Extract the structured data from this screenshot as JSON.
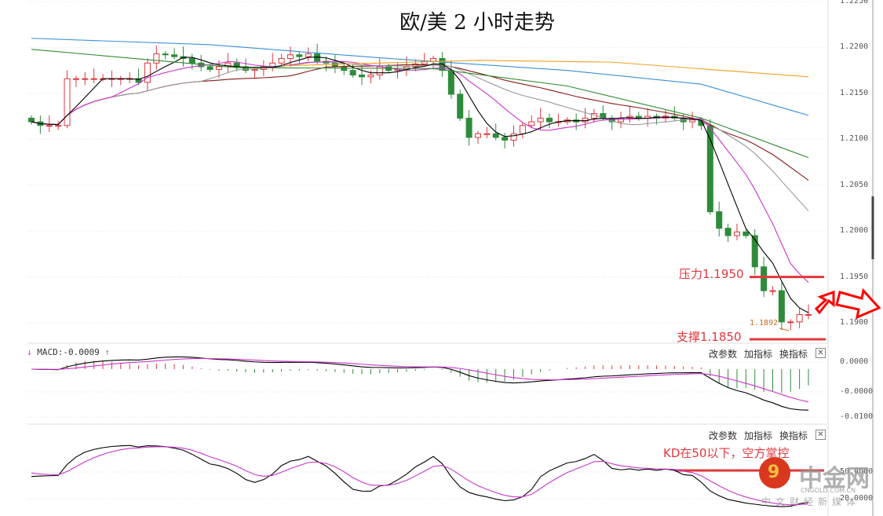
{
  "title": "欧/美 2 小时走势",
  "toolbar": {
    "params": "改参数",
    "add": "加指标",
    "switch": "换指标",
    "close": "✕"
  },
  "macd_label": "MACD:-0.0009",
  "annotations": {
    "resistance": "压力1.1950",
    "support": "支撑1.1850",
    "low": "1.1892",
    "kd_note": "KD在50以下，空方掌控"
  },
  "watermark": {
    "name": "中金网",
    "site": "CNGOLD.COM.CN",
    "slogan": "中文财经新媒体"
  },
  "colors": {
    "up": "#e0383e",
    "down": "#2e8b3a",
    "ma5": "#000000",
    "ma10": "#cc33cc",
    "ma20": "#999999",
    "ma30": "#8b1a1a",
    "ma60": "#2e8b2e",
    "blue": "#3a8fd6",
    "orange": "#f0a020",
    "annot": "#e0383e"
  },
  "chart_data": {
    "type": "candlestick",
    "title": "欧/美 2 小时走势",
    "ylim": [
      1.1895,
      1.225
    ],
    "yticks": [
      "1.2250",
      "1.2200",
      "1.2150",
      "1.2100",
      "1.2050",
      "1.2000",
      "1.1950",
      "1.1900"
    ],
    "macd_ticks": [
      "0.0000",
      "-0.0000",
      "-0.0100"
    ],
    "kd_ticks": [
      "50.0000",
      "20.0000"
    ],
    "closes": [
      1.2119,
      1.2115,
      1.2115,
      1.2115,
      1.2166,
      1.2166,
      1.2166,
      1.2166,
      1.2166,
      1.2166,
      1.2166,
      1.2166,
      1.2162,
      1.2183,
      1.2193,
      1.2192,
      1.219,
      1.2188,
      1.2183,
      1.2179,
      1.2176,
      1.2179,
      1.2183,
      1.2179,
      1.2175,
      1.2176,
      1.2179,
      1.2183,
      1.2188,
      1.2192,
      1.219,
      1.2193,
      1.2185,
      1.2183,
      1.2179,
      1.2175,
      1.217,
      1.2168,
      1.217,
      1.2179,
      1.2175,
      1.2176,
      1.2179,
      1.2182,
      1.2185,
      1.2188,
      1.2175,
      1.2149,
      1.2123,
      1.2102,
      1.2106,
      1.2106,
      1.2102,
      1.2099,
      1.2106,
      1.2115,
      1.2119,
      1.2123,
      1.2119,
      1.2119,
      1.2121,
      1.2119,
      1.2123,
      1.2128,
      1.2123,
      1.2119,
      1.2123,
      1.2125,
      1.2123,
      1.2125,
      1.2123,
      1.2125,
      1.2123,
      1.2119,
      1.2121,
      1.2115,
      1.2021,
      1.2003,
      1.1995,
      1.1999,
      1.1995,
      1.1961,
      1.1935,
      1.1935,
      1.1901,
      1.1901,
      1.1909,
      1.1909
    ],
    "long_lines": [
      {
        "name": "blue",
        "points": [
          [
            0,
            1.221
          ],
          [
            20,
            1.2203
          ],
          [
            40,
            1.2188
          ],
          [
            60,
            1.2175
          ],
          [
            75,
            1.216
          ],
          [
            87,
            1.2126
          ]
        ]
      },
      {
        "name": "orange",
        "points": [
          [
            28,
            1.218
          ],
          [
            50,
            1.2186
          ],
          [
            65,
            1.2184
          ],
          [
            87,
            1.2168
          ]
        ]
      },
      {
        "name": "ma60",
        "points": [
          [
            0,
            1.2198
          ],
          [
            23,
            1.2178
          ],
          [
            45,
            1.2177
          ],
          [
            60,
            1.2158
          ],
          [
            75,
            1.2123
          ],
          [
            87,
            1.208
          ]
        ]
      }
    ],
    "resistance": 1.195,
    "support": 1.185,
    "low_mark": 1.1892
  }
}
